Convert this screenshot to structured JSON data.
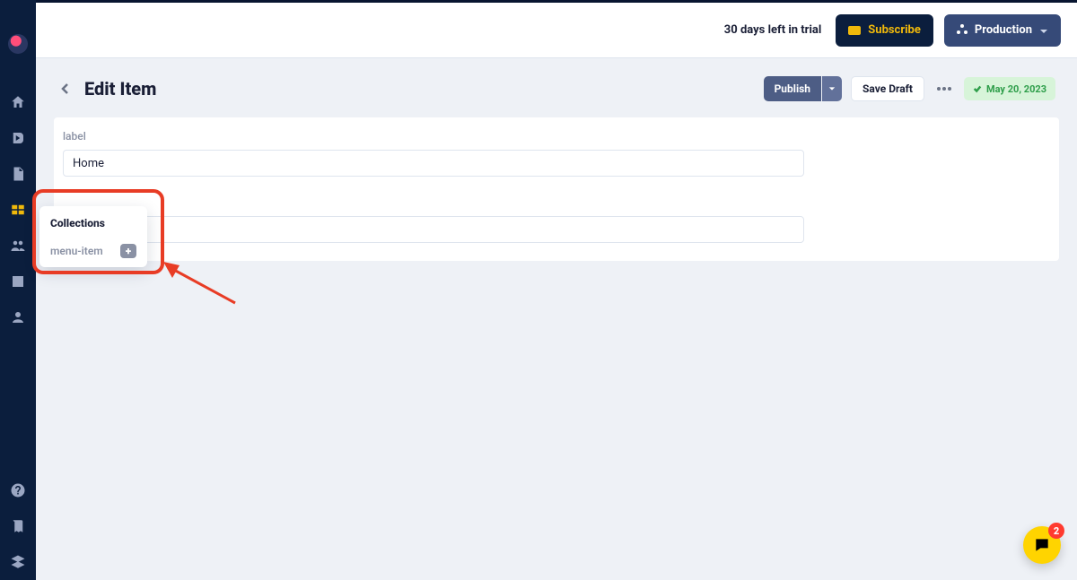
{
  "topbar": {
    "trial_text": "30 days left in trial",
    "subscribe_label": "Subscribe",
    "production_label": "Production"
  },
  "page": {
    "title": "Edit Item",
    "publish_label": "Publish",
    "save_draft_label": "Save Draft",
    "date_badge": "May 20, 2023"
  },
  "form": {
    "label_field_label": "label",
    "label_value": "Home",
    "second_value": ""
  },
  "popover": {
    "title": "Collections",
    "item_name": "menu-item",
    "add_label": "+"
  },
  "chat": {
    "badge_count": "2"
  },
  "sidebar_active_index": 3
}
